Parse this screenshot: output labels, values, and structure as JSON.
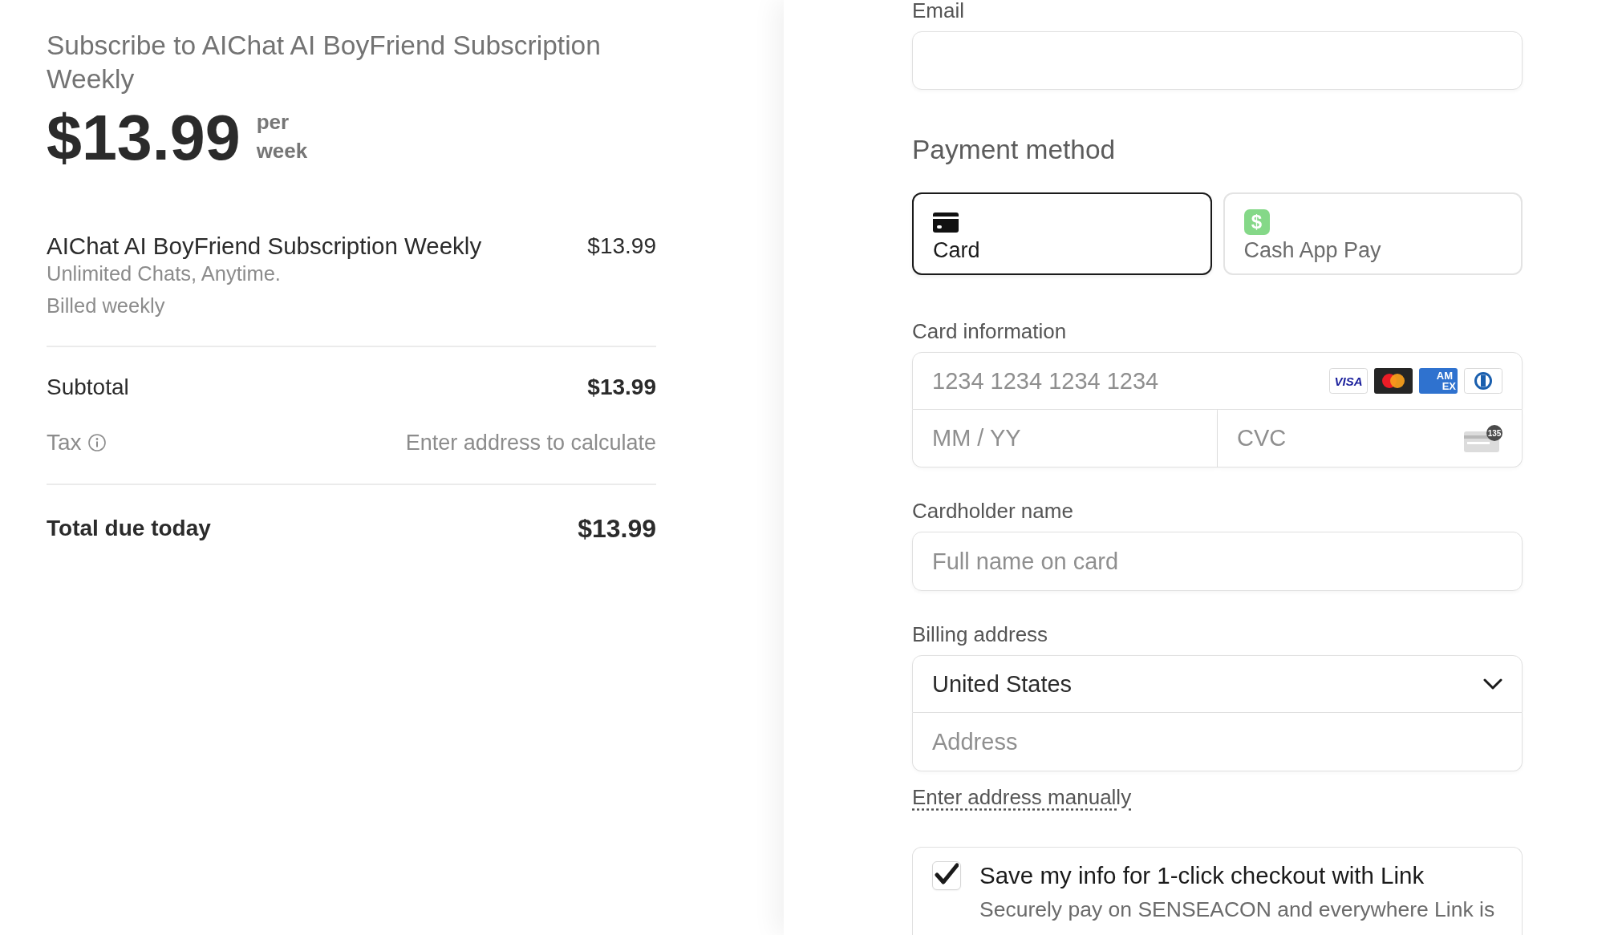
{
  "order_summary": {
    "title": "Subscribe to AIChat AI BoyFriend Subscription Weekly",
    "price": "$13.99",
    "period": "per week",
    "line_items": [
      {
        "name": "AIChat AI BoyFriend Subscription Weekly",
        "description": "Unlimited Chats, Anytime.",
        "billing": "Billed weekly",
        "amount": "$13.99"
      }
    ],
    "subtotal": {
      "label": "Subtotal",
      "amount": "$13.99"
    },
    "tax": {
      "label": "Tax",
      "note": "Enter address to calculate"
    },
    "total": {
      "label": "Total due today",
      "amount": "$13.99"
    }
  },
  "checkout": {
    "email": {
      "label": "Email"
    },
    "payment_method": {
      "heading": "Payment method",
      "options": [
        {
          "kind": "card",
          "label": "Card",
          "selected": true
        },
        {
          "kind": "cash_app",
          "icon": "$",
          "label": "Cash App Pay",
          "selected": false
        }
      ]
    },
    "card_information": {
      "label": "Card information",
      "number_placeholder": "1234 1234 1234 1234",
      "brands": [
        {
          "kind": "visa",
          "text": "VISA"
        },
        {
          "kind": "mastercard"
        },
        {
          "kind": "amex",
          "lines": [
            "AM",
            "EX"
          ]
        },
        {
          "kind": "diners"
        }
      ],
      "expiry_placeholder": "MM / YY",
      "cvc_placeholder": "CVC",
      "cvc_hint": "135"
    },
    "cardholder_name": {
      "label": "Cardholder name",
      "placeholder": "Full name on card"
    },
    "billing_address": {
      "label": "Billing address",
      "country": "United States",
      "address_placeholder": "Address",
      "manual_link": "Enter address manually"
    },
    "save_info": {
      "checked": true,
      "label": "Save my info for 1-click checkout with Link",
      "description": "Securely pay on SENSEACON and everywhere Link is"
    }
  }
}
